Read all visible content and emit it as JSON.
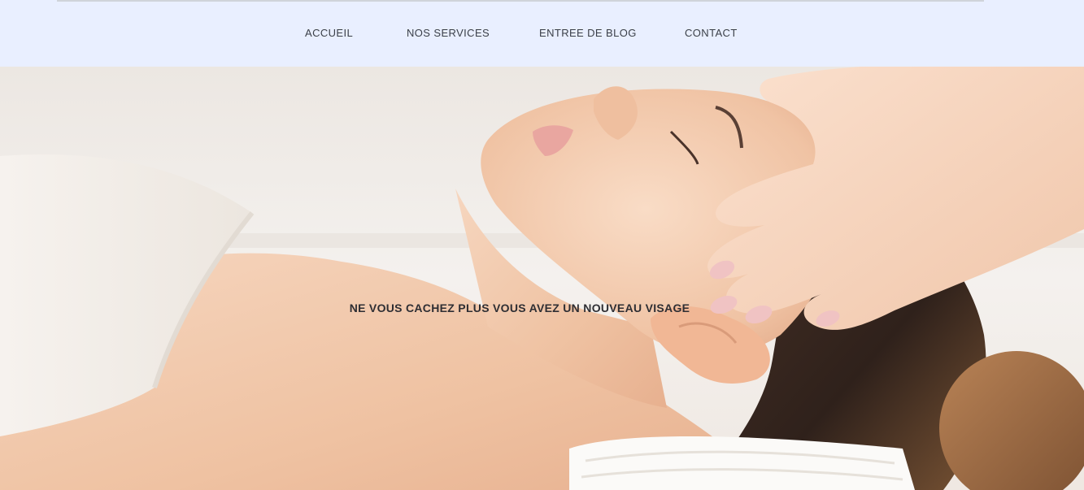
{
  "nav": {
    "items": [
      {
        "label": "ACCUEIL"
      },
      {
        "label": "NOS SERVICES"
      },
      {
        "label": "ENTREE DE BLOG"
      },
      {
        "label": "CONTACT"
      }
    ]
  },
  "hero": {
    "tagline": "NE VOUS CACHEZ PLUS VOUS AVEZ UN NOUVEAU VISAGE",
    "image_subject": "facial-massage-photo"
  },
  "colors": {
    "header_bg": "#e9efff",
    "nav_text": "#3a3f47",
    "tagline_text": "#2e2e33",
    "skin": "#f1c9ab",
    "hair": "#3b2a22",
    "towel": "#f5f1ec"
  }
}
